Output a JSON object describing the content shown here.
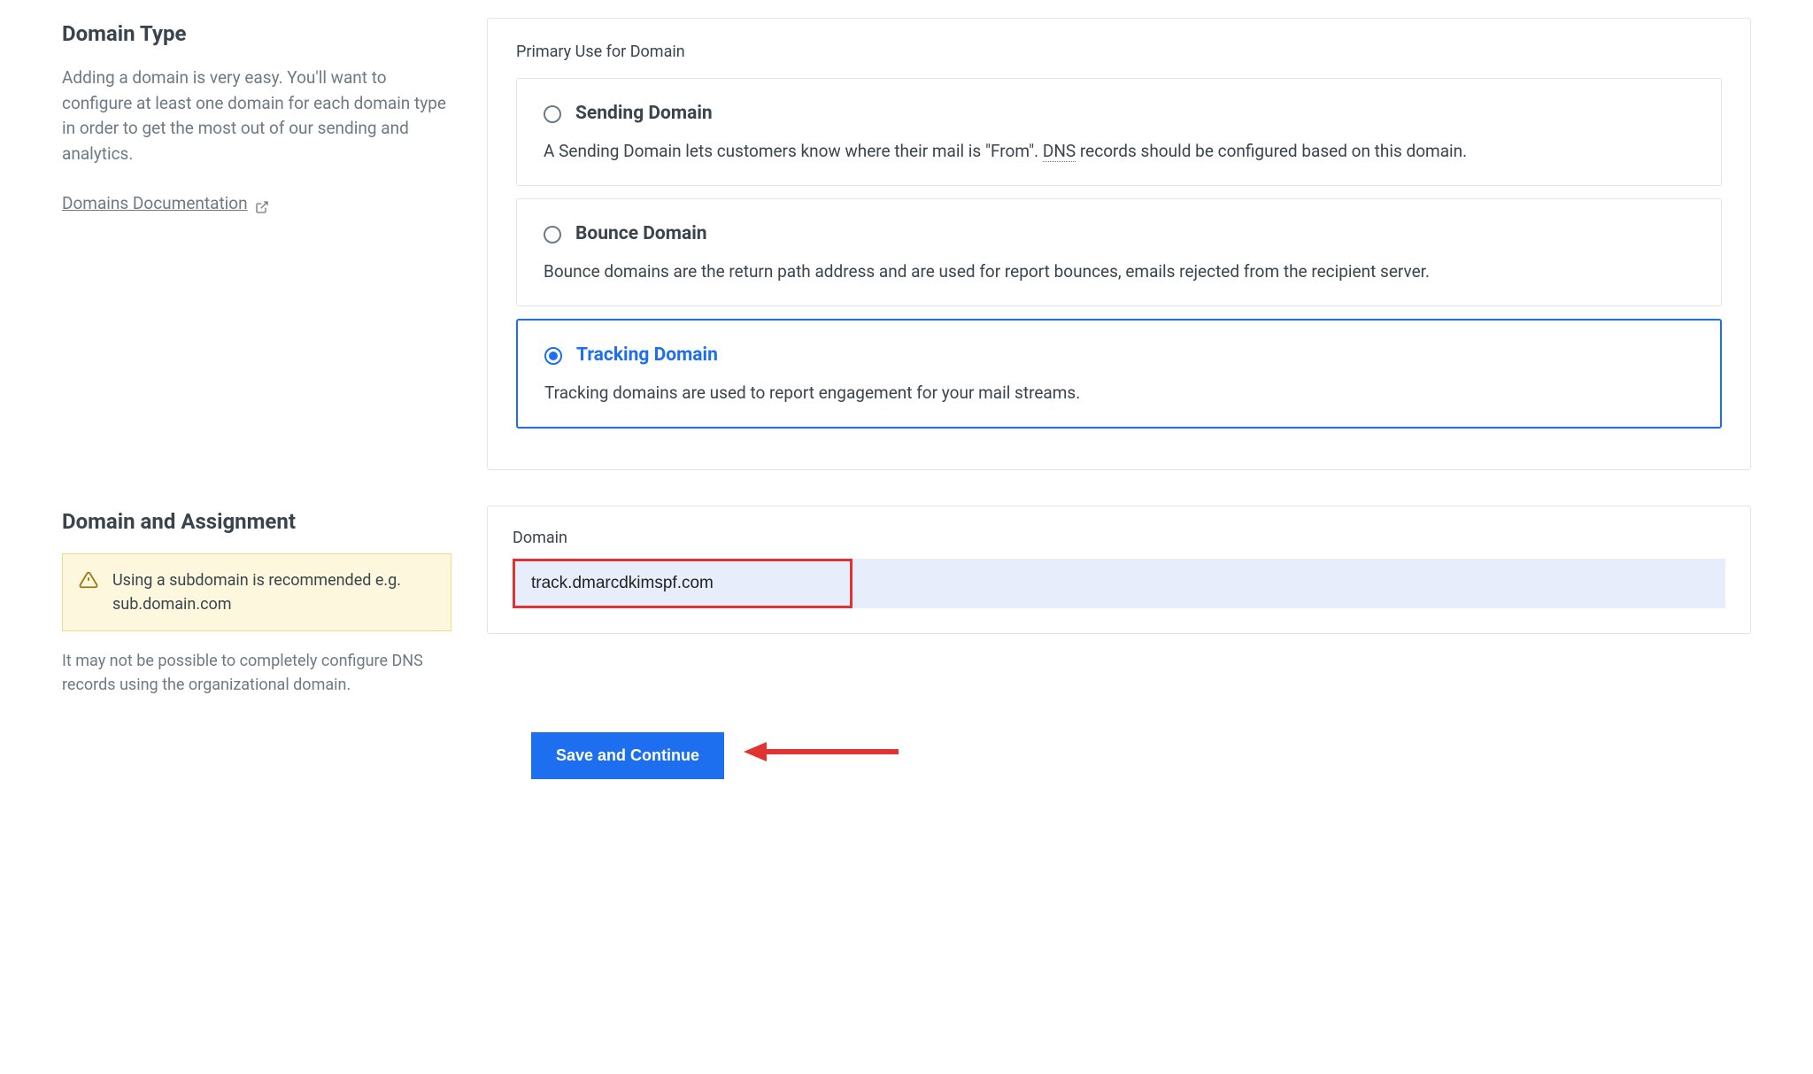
{
  "section1": {
    "title": "Domain Type",
    "description": "Adding a domain is very easy. You'll want to configure at least one domain for each domain type in order to get the most out of our sending and analytics.",
    "doc_link": "Domains Documentation",
    "primary_use_label": "Primary Use for Domain",
    "options": [
      {
        "title": "Sending Domain",
        "desc_pre": "A Sending Domain lets customers know where their mail is \"From\". ",
        "dns": "DNS",
        "desc_post": " records should be configured based on this domain."
      },
      {
        "title": "Bounce Domain",
        "desc": "Bounce domains are the return path address and are used for report bounces, emails rejected from the recipient server."
      },
      {
        "title": "Tracking Domain",
        "desc": "Tracking domains are used to report engagement for your mail streams."
      }
    ]
  },
  "section2": {
    "title": "Domain and Assignment",
    "alert": "Using a subdomain is recommended e.g. sub.domain.com",
    "helper": "It may not be possible to completely configure DNS records using the organizational domain.",
    "domain_label": "Domain",
    "domain_value": "track.dmarcdkimspf.com"
  },
  "actions": {
    "save": "Save and Continue"
  }
}
